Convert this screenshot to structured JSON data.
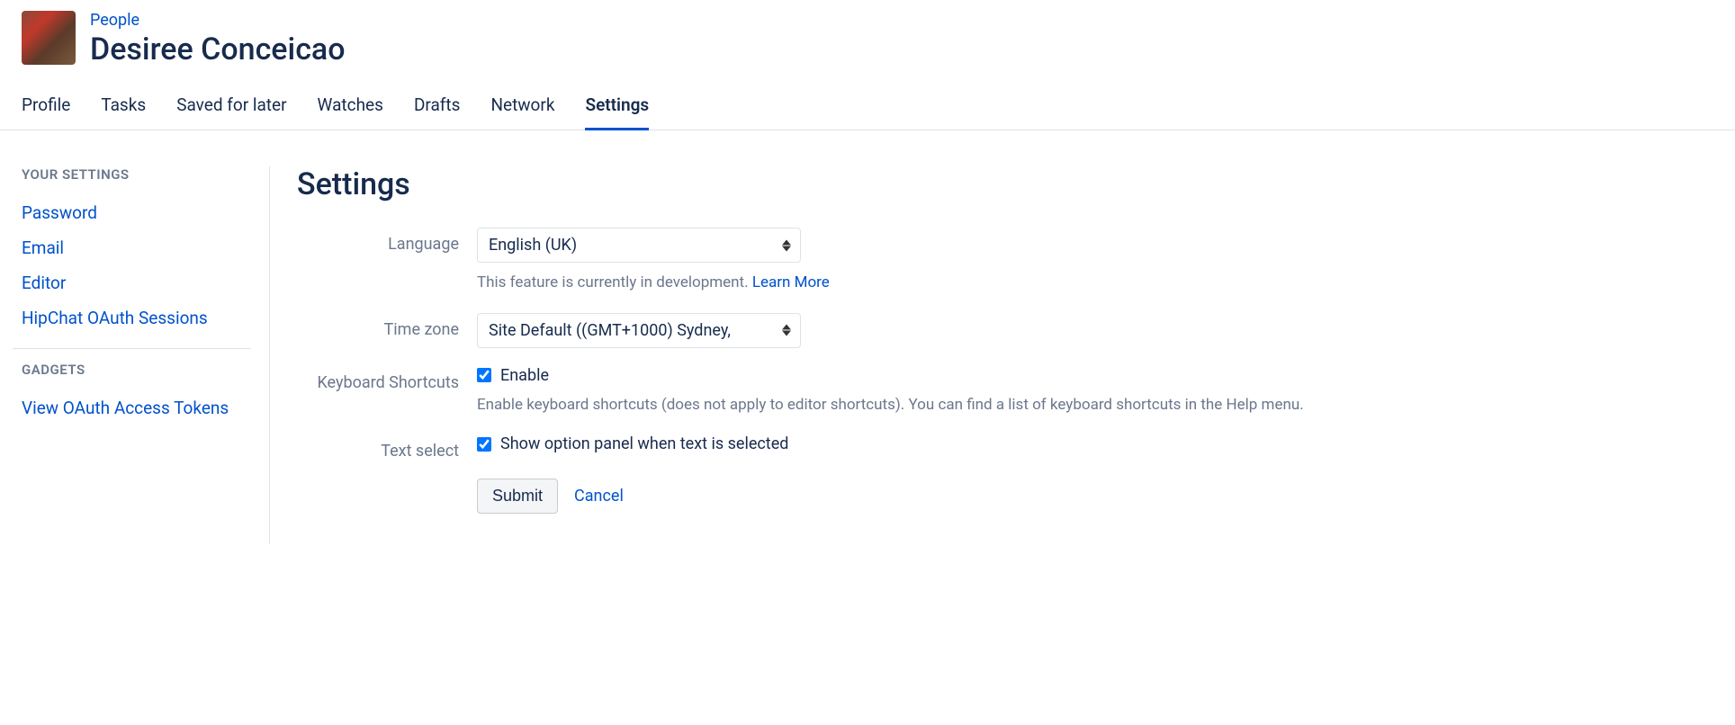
{
  "header": {
    "breadcrumb": "People",
    "user_name": "Desiree Conceicao"
  },
  "tabs": [
    {
      "label": "Profile",
      "active": false
    },
    {
      "label": "Tasks",
      "active": false
    },
    {
      "label": "Saved for later",
      "active": false
    },
    {
      "label": "Watches",
      "active": false
    },
    {
      "label": "Drafts",
      "active": false
    },
    {
      "label": "Network",
      "active": false
    },
    {
      "label": "Settings",
      "active": true
    }
  ],
  "sidebar": {
    "section1_title": "YOUR SETTINGS",
    "section1_items": [
      "Password",
      "Email",
      "Editor",
      "HipChat OAuth Sessions"
    ],
    "section2_title": "GADGETS",
    "section2_items": [
      "View OAuth Access Tokens"
    ]
  },
  "main": {
    "title": "Settings",
    "language": {
      "label": "Language",
      "value": "English (UK)",
      "help_text": "This feature is currently in development. ",
      "learn_more": "Learn More"
    },
    "timezone": {
      "label": "Time zone",
      "value": "Site Default ((GMT+1000) Sydney,"
    },
    "keyboard_shortcuts": {
      "label": "Keyboard Shortcuts",
      "checkbox_label": "Enable",
      "checked": true,
      "help_text": "Enable keyboard shortcuts (does not apply to editor shortcuts). You can find a list of keyboard shortcuts in the Help menu."
    },
    "text_select": {
      "label": "Text select",
      "checkbox_label": "Show option panel when text is selected",
      "checked": true
    },
    "actions": {
      "submit": "Submit",
      "cancel": "Cancel"
    }
  }
}
